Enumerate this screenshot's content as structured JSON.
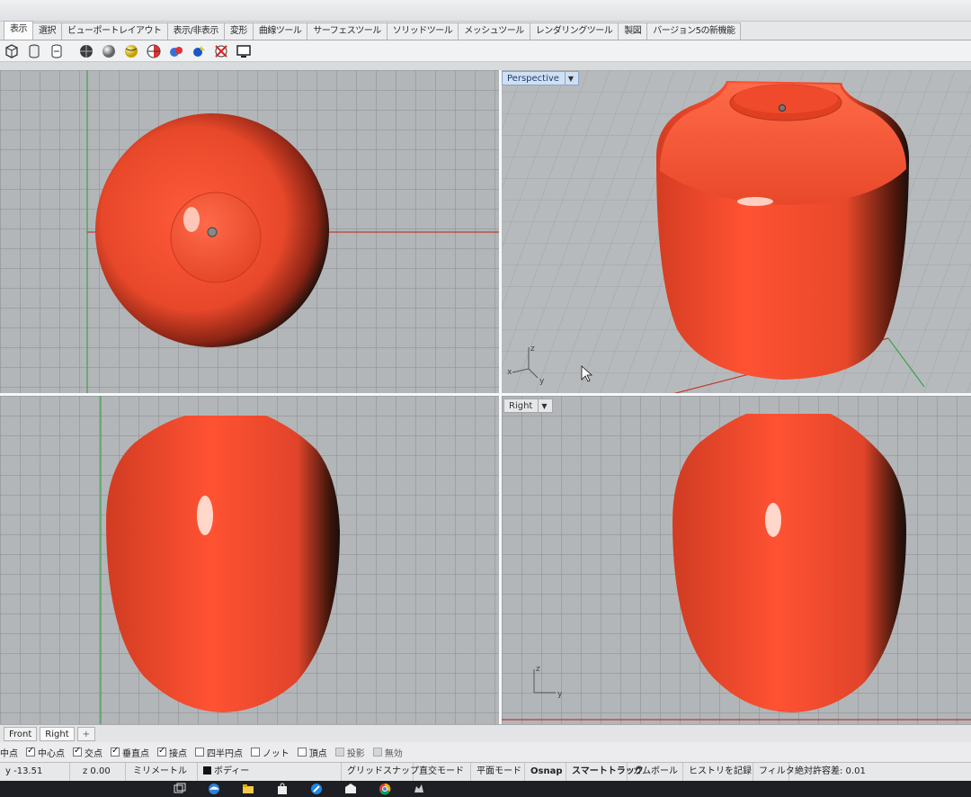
{
  "ribbon_tabs": [
    "表示",
    "選択",
    "ビューポートレイアウト",
    "表示/非表示",
    "変形",
    "曲線ツール",
    "サーフェスツール",
    "ソリッドツール",
    "メッシュツール",
    "レンダリングツール",
    "製図",
    "バージョン5の新機能"
  ],
  "toolbar_icons": [
    "wireframe-view-icon",
    "shaded-view-icon",
    "rendered-view-icon",
    "ghosted-view-icon",
    "xray-view-icon",
    "technical-view-icon",
    "artistic-view-icon",
    "pen-view-icon",
    "render-icon",
    "render-preview-icon",
    "material-icon",
    "light-icon",
    "monitor-icon"
  ],
  "viewports": {
    "perspective_label": "Perspective",
    "right_label": "Right",
    "axis_x": "x",
    "axis_y": "y",
    "axis_z": "z"
  },
  "colors": {
    "object": "#e8482a",
    "object_shadow": "#1a0f0c",
    "grid_bg": "#b3b6b9",
    "x_axis": "#c03a35",
    "y_axis": "#3aa24a",
    "label_bg": "#cfe0f2"
  },
  "viewport_tabs": [
    "Front",
    "Right",
    "+"
  ],
  "osnaps": [
    {
      "label": "中点",
      "checked": null
    },
    {
      "label": "中心点",
      "checked": true
    },
    {
      "label": "交点",
      "checked": true
    },
    {
      "label": "垂直点",
      "checked": true
    },
    {
      "label": "接点",
      "checked": true
    },
    {
      "label": "四半円点",
      "checked": false
    },
    {
      "label": "ノット",
      "checked": false
    },
    {
      "label": "頂点",
      "checked": false
    },
    {
      "label": "投影",
      "checked": false
    },
    {
      "label": "無効",
      "checked": false
    }
  ],
  "status": {
    "y": "y -13.51",
    "z": "z 0.00",
    "units": "ミリメートル",
    "layer": "ボディー",
    "grid_snap": "グリッドスナップ",
    "ortho": "直交モード",
    "planar": "平面モード",
    "osnap": "Osnap",
    "smarttrack": "スマートトラック",
    "gumball": "ガムボール",
    "history": "ヒストリを記録",
    "filter": "フィルタ",
    "tolerance": "絶対許容差: 0.01"
  },
  "taskbar_icons": [
    "task-view-icon",
    "edge-icon",
    "file-explorer-icon",
    "store-icon",
    "paint-icon",
    "mail-icon",
    "chrome-icon",
    "rhino-icon"
  ]
}
